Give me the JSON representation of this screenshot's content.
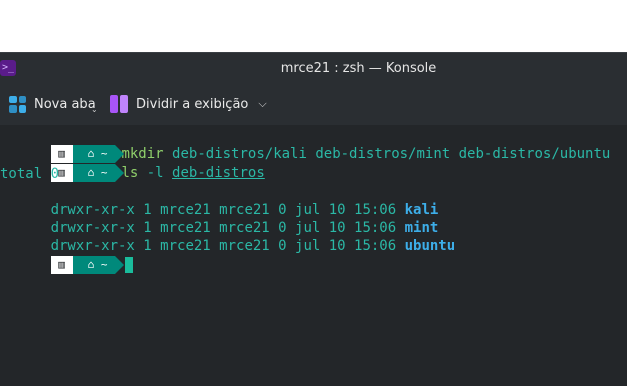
{
  "window": {
    "title": "mrce21 : zsh — Konsole",
    "app_icon": ">_"
  },
  "toolbar": {
    "new_tab_label": "Nova aba",
    "split_label": "Dividir a exibição"
  },
  "prompt": {
    "os_icon": "▥",
    "dir": "⌂ ~"
  },
  "terminal": {
    "lines": [
      {
        "cmd": "mkdir",
        "args": "deb-distros/kali deb-distros/mint deb-distros/ubuntu"
      },
      {
        "cmd": "ls",
        "flag": "-l",
        "path": "deb-distros"
      }
    ],
    "total": "total 0",
    "entries": [
      {
        "meta": "drwxr-xr-x 1 mrce21 mrce21 0 jul 10 15:06",
        "name": "kali"
      },
      {
        "meta": "drwxr-xr-x 1 mrce21 mrce21 0 jul 10 15:06",
        "name": "mint"
      },
      {
        "meta": "drwxr-xr-x 1 mrce21 mrce21 0 jul 10 15:06",
        "name": "ubuntu"
      }
    ]
  },
  "colors": {
    "background": "#232629",
    "prompt_dir_bg": "#00897b",
    "command": "#8fcf6b",
    "output": "#2bb8a6",
    "directory": "#3daee9",
    "cursor": "#1abc9c"
  }
}
